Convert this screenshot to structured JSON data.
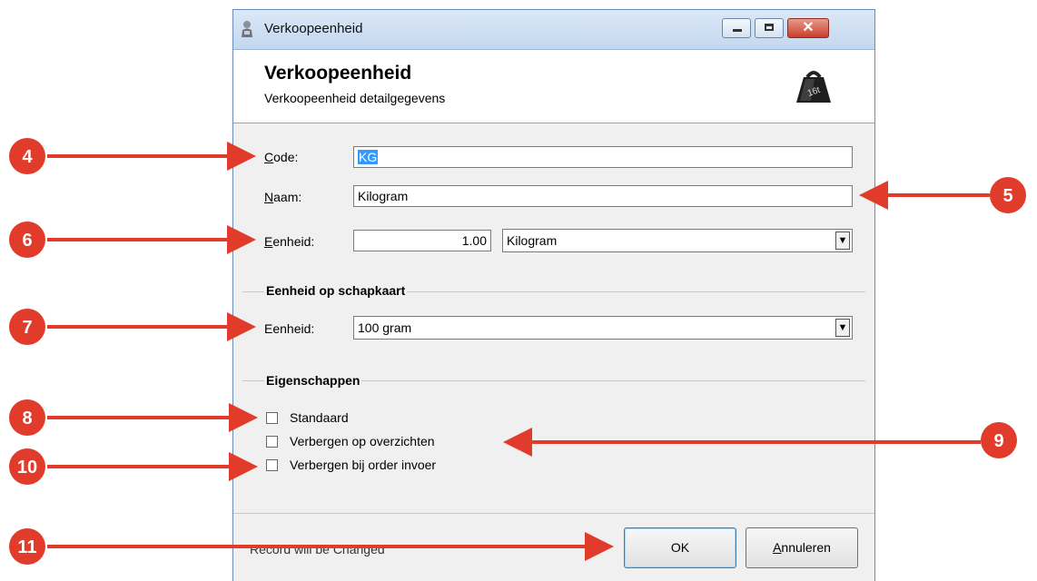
{
  "window": {
    "title": "Verkoopeenheid",
    "close_glyph": "✕",
    "header_title": "Verkoopeenheid",
    "header_subtitle": "Verkoopeenheid detailgegevens",
    "header_icon": "weight-icon"
  },
  "form": {
    "code_label_accel": "C",
    "code_label_rest": "ode:",
    "code_value": "KG",
    "naam_label_accel": "N",
    "naam_label_rest": "aam:",
    "naam_value": "Kilogram",
    "eenheid_label_accel": "E",
    "eenheid_label_rest": "enheid:",
    "eenheid_amount": "1.00",
    "eenheid_unit": "Kilogram"
  },
  "shelf_group": {
    "title": "Eenheid op schapkaart",
    "eenheid_label": "Eenheid:",
    "eenheid_value": "100 gram"
  },
  "props_group": {
    "title": "Eigenschappen",
    "standaard": {
      "label": "Standaard",
      "checked": false
    },
    "verbergen_overzichten": {
      "label": "Verbergen op overzichten",
      "checked": false
    },
    "verbergen_order": {
      "label": "Verbergen bij order invoer",
      "checked": false
    }
  },
  "footer": {
    "status": "Record will be Changed",
    "ok_label": "OK",
    "cancel_accel": "A",
    "cancel_rest": "nnuleren"
  },
  "annotations": {
    "badges": [
      "4",
      "5",
      "6",
      "7",
      "8",
      "9",
      "10",
      "11"
    ],
    "color": "#e03b2b"
  }
}
